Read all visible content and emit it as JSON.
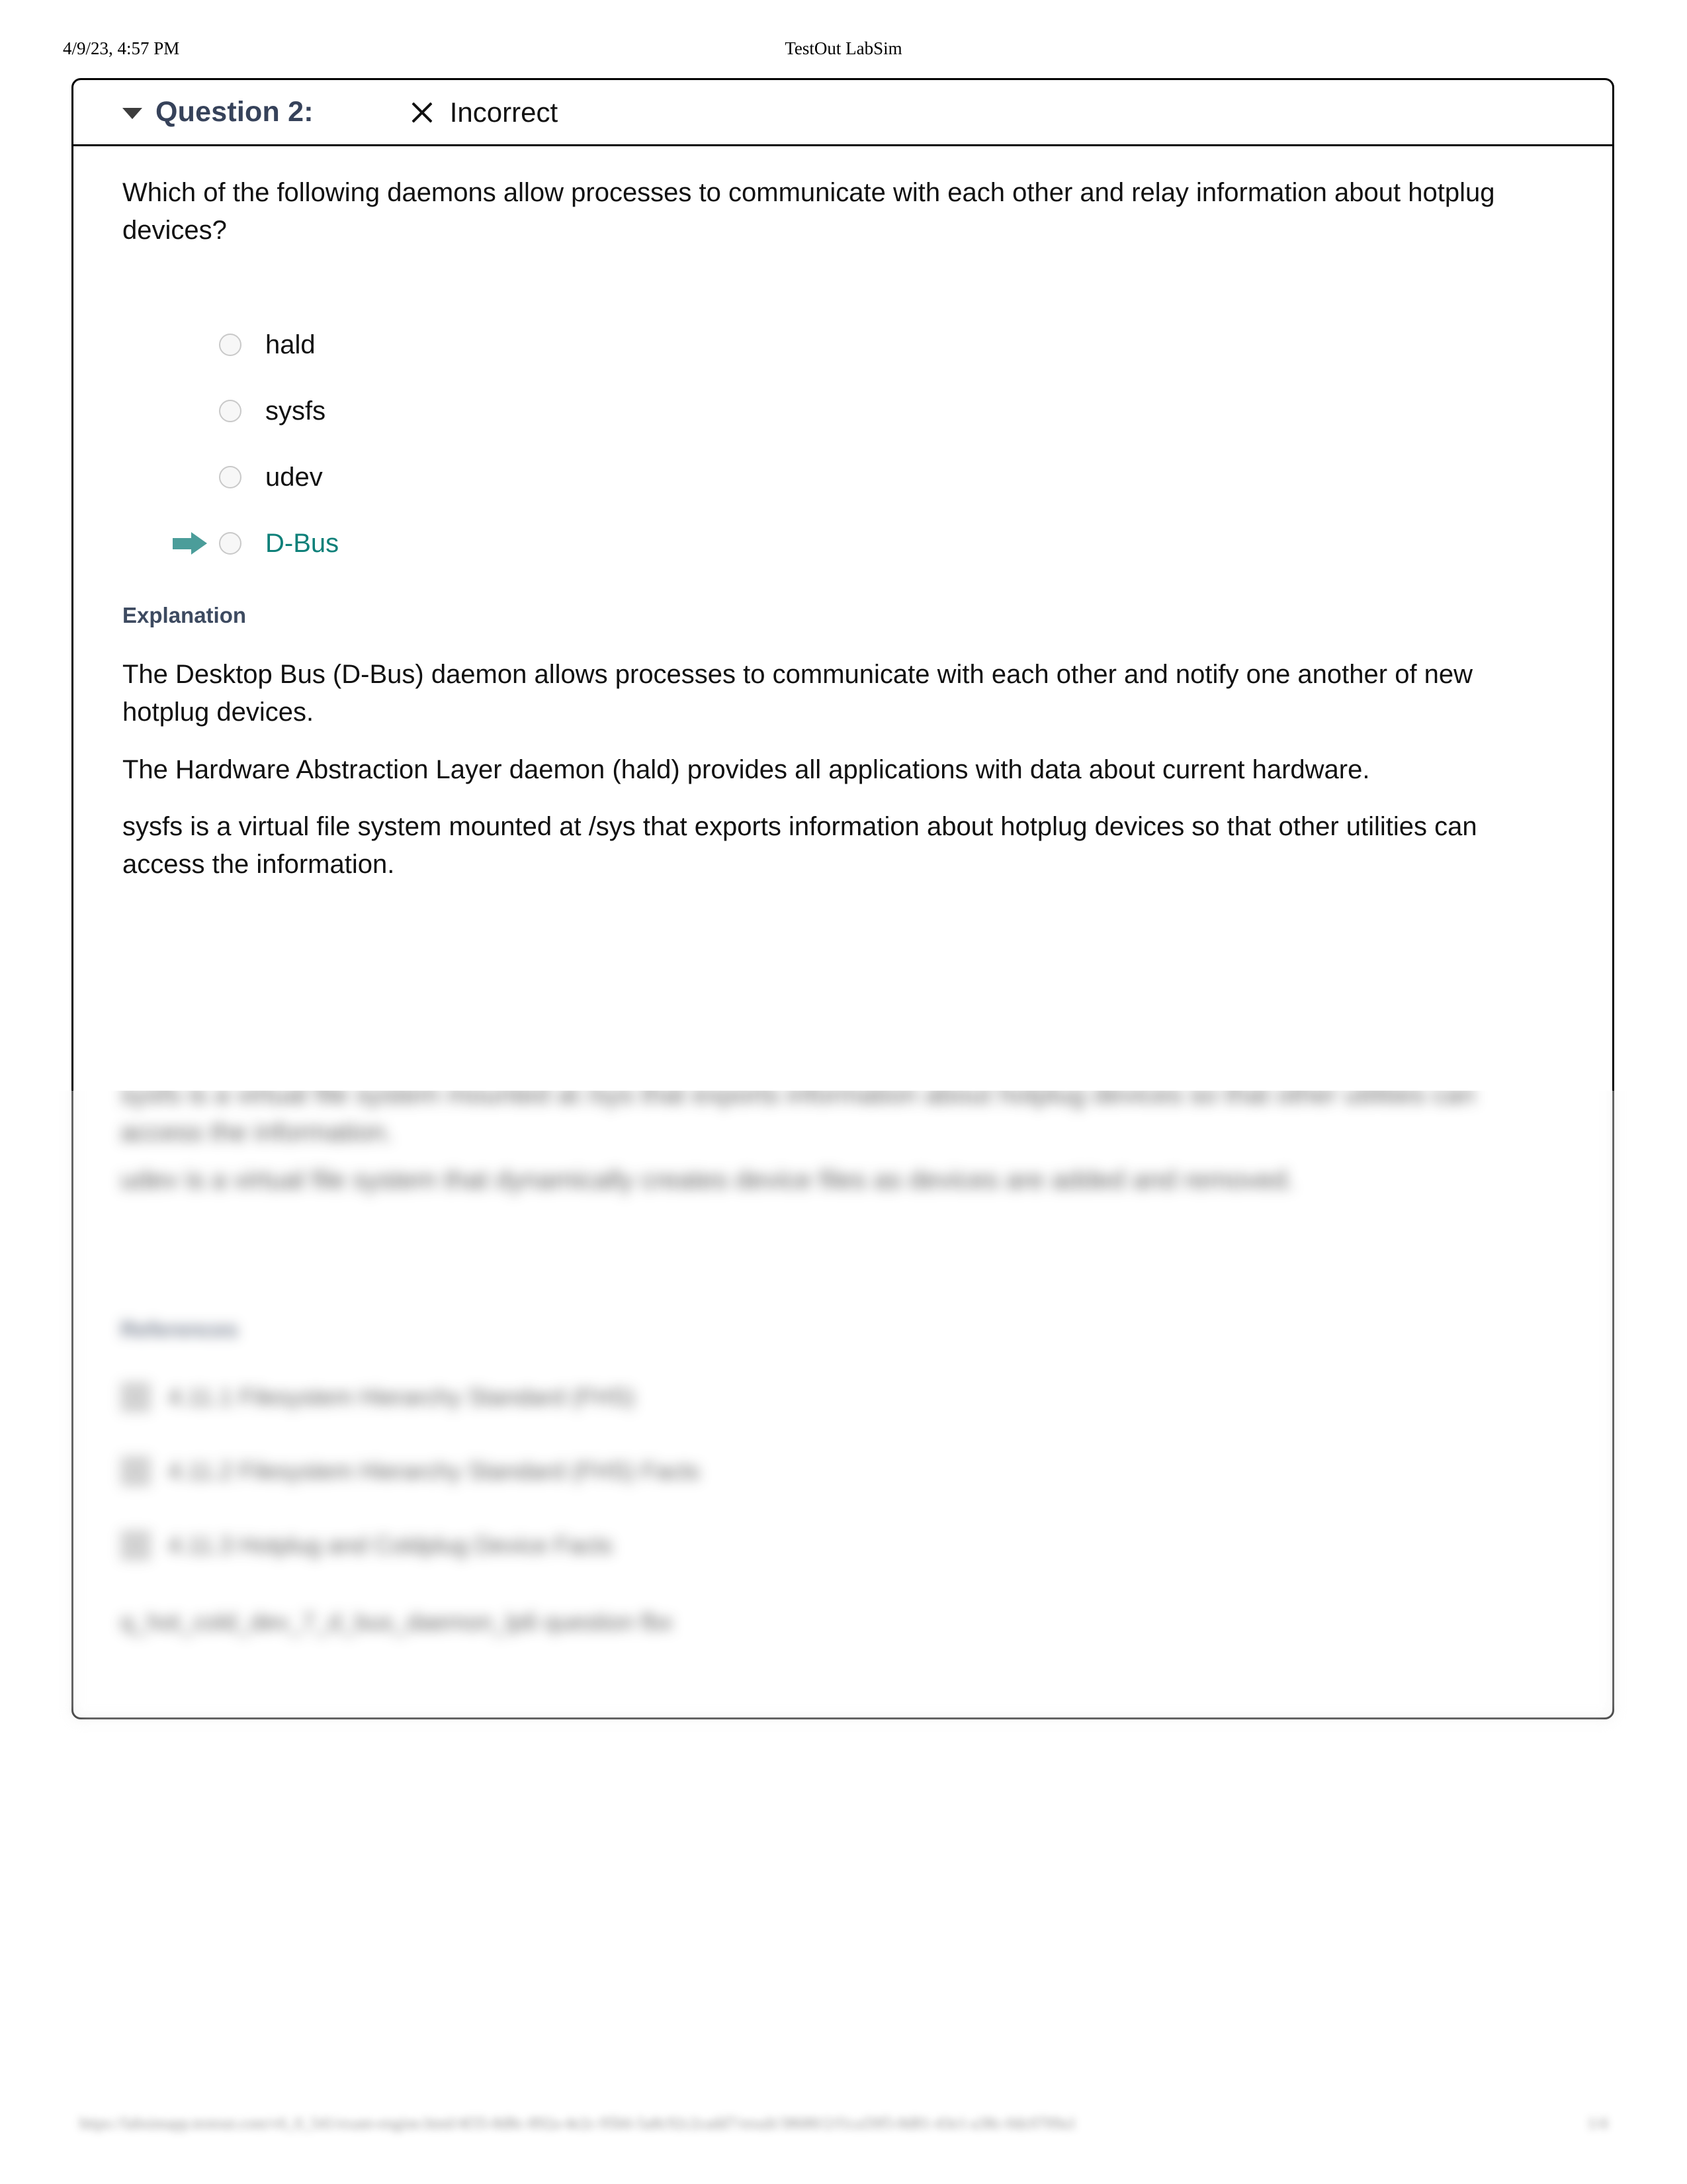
{
  "print_header": {
    "date": "4/9/23, 4:57 PM",
    "title": "TestOut LabSim"
  },
  "question_card": {
    "caret_icon": "triangle-down-icon",
    "label": "Question 2:",
    "status_icon": "x-mark-icon",
    "status_text": "Incorrect",
    "question_text": "Which of the following daemons allow processes to communicate with each other and relay information about hotplug devices?",
    "correct_marker_icon": "arrow-right-icon",
    "options": [
      {
        "label": "hald",
        "selected": false,
        "correct": false
      },
      {
        "label": "sysfs",
        "selected": false,
        "correct": false
      },
      {
        "label": "udev",
        "selected": false,
        "correct": false
      },
      {
        "label": "D-Bus",
        "selected": false,
        "correct": true
      }
    ],
    "explanation": {
      "heading": "Explanation",
      "paragraphs": [
        "The Desktop Bus (D-Bus) daemon allows processes to communicate with each other and notify one another of new hotplug devices.",
        "The Hardware Abstraction Layer daemon (hald) provides all applications with data about current hardware.",
        "sysfs is a virtual file system mounted at /sys that exports information about hotplug devices so that other utilities can access the information.",
        "udev is a virtual file system that dynamically creates device files as devices are added and removed."
      ]
    },
    "references": {
      "heading": "References",
      "items": [
        {
          "icon": "document-icon",
          "text": "4.11.1 Filesystem Hierarchy Standard (FHS)"
        },
        {
          "icon": "document-icon",
          "text": "4.11.2 Filesystem Hierarchy Standard (FHS) Facts"
        },
        {
          "icon": "document-icon",
          "text": "4.11.3 Hotplug and Coldplug Device Facts"
        }
      ],
      "tag_line": "q_hot_cold_dev_7_d_bus_daemon_lp6 question fbx"
    }
  },
  "colors": {
    "question_label": "#36425a",
    "correct_accent": "#0e8079",
    "arrow_accent": "#4b9d9a",
    "explanation_heading": "#3d4a60",
    "card_border": "#000000"
  },
  "print_footer": {
    "url": "https://labsimapp.testout.com/v6_0_541/exam-engine.html/4f35-8d8c-892a-4e2c-95b6-5a8c92c2cadd7/result/38680/2/f1ca59f5-8d81-43e1-a38c-0dc0709a1",
    "page": "1/4"
  }
}
